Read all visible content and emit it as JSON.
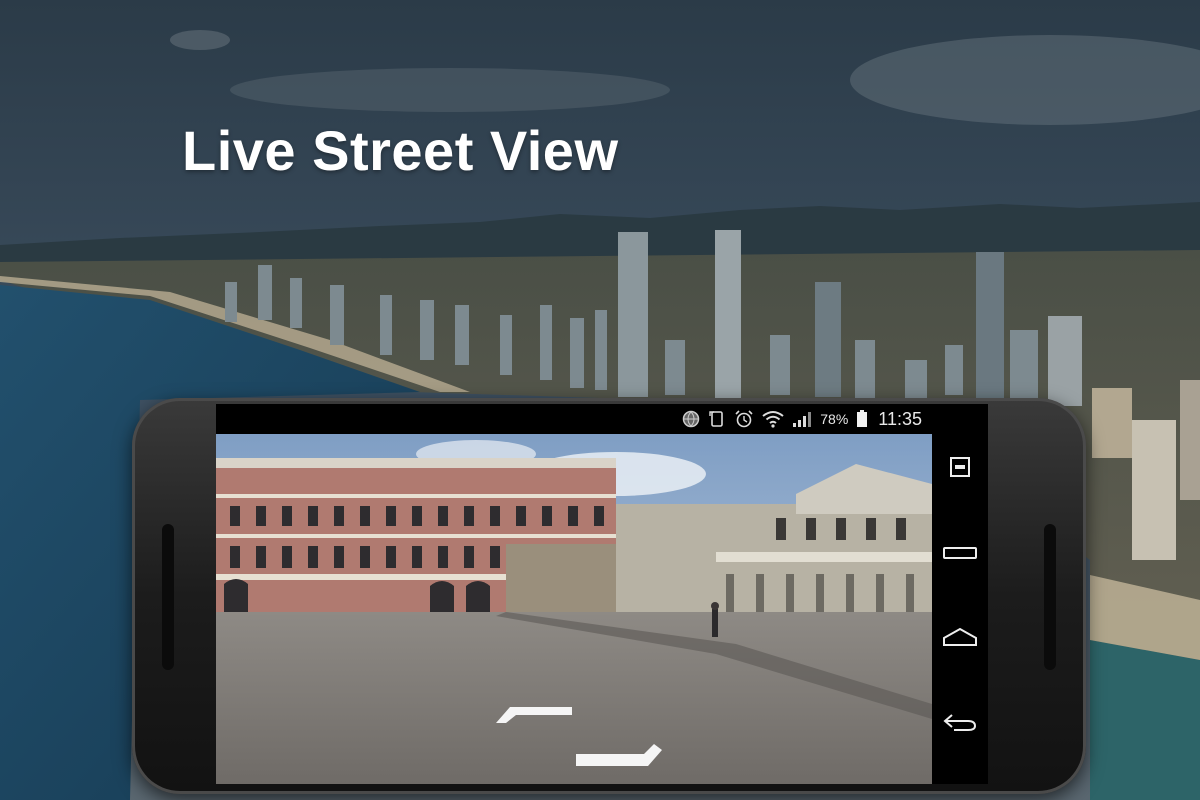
{
  "promo": {
    "headline": "Live Street View"
  },
  "status_bar": {
    "battery_percent": "78%",
    "time": "11:35",
    "icons": [
      "globe-icon",
      "screen-rotation-icon",
      "alarm-icon",
      "wifi-icon",
      "signal-icon",
      "battery-icon"
    ]
  },
  "nav_bar": {
    "icons": [
      "recent-apps-icon",
      "minimize-icon",
      "home-icon",
      "back-icon"
    ]
  },
  "colors": {
    "sky_top": "#2e3e4c",
    "sea": "#1f4a66",
    "phone_body": "#1c1c1c",
    "text": "#ffffff"
  }
}
